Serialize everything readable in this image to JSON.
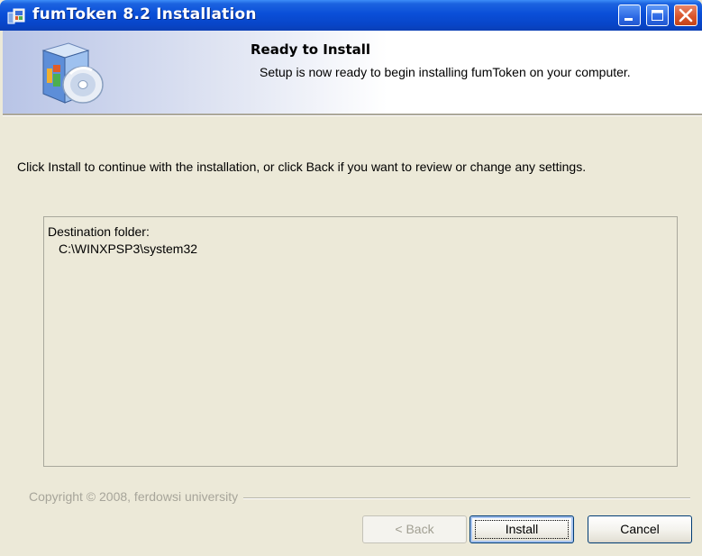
{
  "window": {
    "title": "fumToken 8.2 Installation",
    "controls": [
      "minimize-icon",
      "maximize-icon",
      "close-icon"
    ],
    "accent_color": "#0a4fd8"
  },
  "header": {
    "title": "Ready to Install",
    "description": "Setup is now ready to begin installing fumToken on your computer.",
    "icon": "setup-box-cd-icon"
  },
  "body": {
    "instruction": "Click Install to continue with the installation, or click Back if you want to review or change any settings.",
    "memo": {
      "label": "Destination folder:",
      "value": "C:\\WINXPSP3\\system32"
    }
  },
  "footer": {
    "copyright": "Copyright © 2008, ferdowsi university",
    "buttons": {
      "back": "< Back",
      "install": "Install",
      "cancel": "Cancel"
    }
  }
}
